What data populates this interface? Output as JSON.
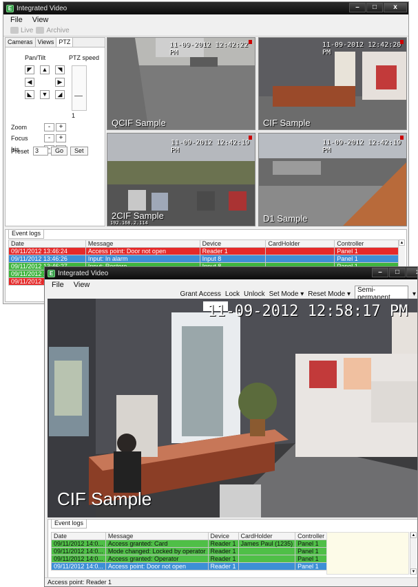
{
  "win1": {
    "title": "Integrated Video",
    "menu": [
      "File",
      "View"
    ],
    "toolbar": {
      "live": "Live",
      "archive": "Archive"
    },
    "tabs": [
      "Cameras",
      "Views",
      "PTZ"
    ],
    "ptz": {
      "pan_tilt_label": "Pan/Tilt",
      "speed_label": "PTZ speed",
      "speed_value": "1",
      "zoom_label": "Zoom",
      "focus_label": "Focus",
      "iris_label": "Iris",
      "minus": "-",
      "plus": "+",
      "preset_label": "Preset",
      "preset_value": "3",
      "go_label": "Go",
      "set_label": "Set"
    },
    "tiles": [
      {
        "name": "QCIF Sample",
        "timestamp": "11-09-2012 12:42:22 PM"
      },
      {
        "name": "CIF Sample",
        "timestamp": "11-09-2012 12:42:20 PM"
      },
      {
        "name": "2CIF Sample",
        "timestamp": "11-09-2012 12:42:19 PM",
        "sub": "192.168.2.114"
      },
      {
        "name": "D1 Sample",
        "timestamp": "11-09-2012 12:42:19 PM"
      }
    ],
    "event_logs": {
      "tab": "Event logs",
      "columns": [
        "Date",
        "Message",
        "Device",
        "CardHolder",
        "Controller"
      ],
      "rows": [
        {
          "date": "09/11/2012 13:46:24",
          "message": "Access point: Door not open",
          "device": "Reader 1",
          "cardholder": "",
          "controller": "Panel 1",
          "color": "red"
        },
        {
          "date": "09/11/2012 13:46:26",
          "message": "Input: In alarm",
          "device": "Input 8",
          "cardholder": "",
          "controller": "Panel 1",
          "color": "blue"
        },
        {
          "date": "09/11/2012 13:46:27",
          "message": "Input: Restore",
          "device": "Input 8",
          "cardholder": "",
          "controller": "Panel 1",
          "color": "green"
        },
        {
          "date": "09/11/2012 13:46:",
          "message": "",
          "device": "",
          "cardholder": "",
          "controller": "",
          "color": "green"
        },
        {
          "date": "09/11/2012 13:46:",
          "message": "",
          "device": "",
          "cardholder": "",
          "controller": "",
          "color": "red"
        }
      ]
    }
  },
  "win2": {
    "title": "Integrated Video",
    "menu": [
      "File",
      "View"
    ],
    "actions": {
      "grant_access": "Grant Access",
      "lock": "Lock",
      "unlock": "Unlock",
      "set_mode": "Set Mode",
      "reset_mode": "Reset Mode",
      "mode_value": "Semi-permanent"
    },
    "video": {
      "name": "CIF Sample",
      "timestamp": "11-09-2012 12:58:17 PM"
    },
    "event_logs": {
      "tab": "Event logs",
      "columns": [
        "Date",
        "Message",
        "Device",
        "CardHolder",
        "Controller"
      ],
      "rows": [
        {
          "date": "09/11/2012 14:0...",
          "message": "Access granted: Card",
          "device": "Reader 1",
          "cardholder": "James Paul (1235)",
          "controller": "Panel 1",
          "color": "green2"
        },
        {
          "date": "09/11/2012 14:0...",
          "message": "Mode changed: Locked by operator",
          "device": "Reader 1",
          "cardholder": "",
          "controller": "Panel 1",
          "color": "green2"
        },
        {
          "date": "09/11/2012 14:0...",
          "message": "Access granted: Operator",
          "device": "Reader 1",
          "cardholder": "",
          "controller": "Panel 1",
          "color": "green2"
        },
        {
          "date": "09/11/2012 14:0...",
          "message": "Access point: Door not open",
          "device": "Reader 1",
          "cardholder": "",
          "controller": "Panel 1",
          "color": "blue"
        }
      ]
    },
    "status": "Access point: Reader 1"
  },
  "colors": {
    "red": "#e52a2a",
    "blue": "#3d8fd6",
    "green": "#3fb53f",
    "titlebar": "#111111"
  }
}
